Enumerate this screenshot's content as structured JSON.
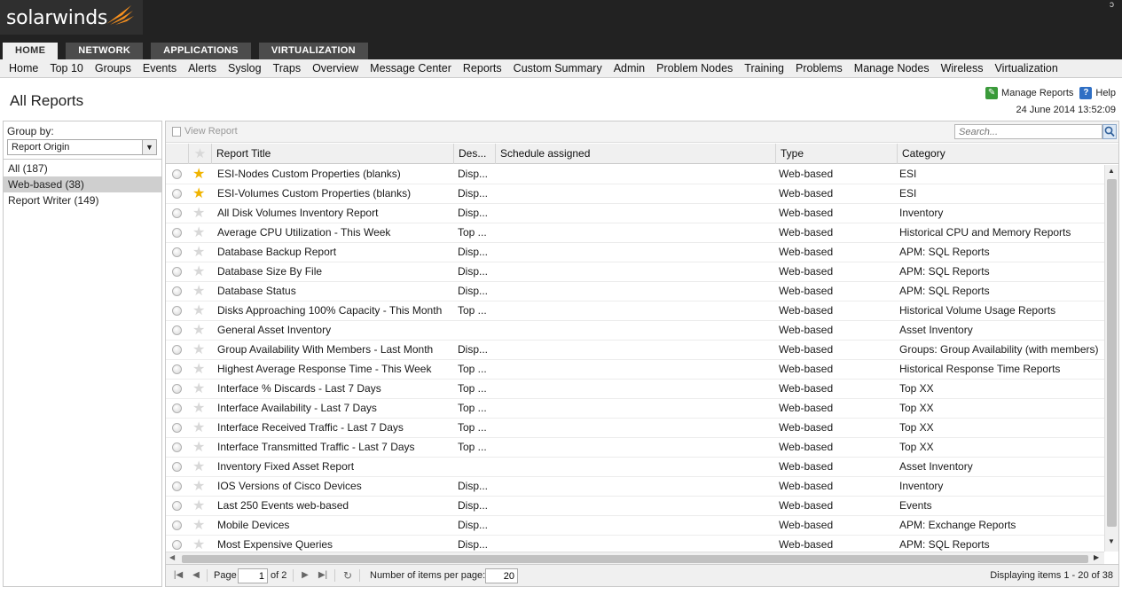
{
  "header": {
    "brand": "solarwinds",
    "corner_mark": "ɔ"
  },
  "modules": [
    "HOME",
    "NETWORK",
    "APPLICATIONS",
    "VIRTUALIZATION"
  ],
  "menu": [
    "Home",
    "Top 10",
    "Groups",
    "Events",
    "Alerts",
    "Syslog",
    "Traps",
    "Overview",
    "Message Center",
    "Reports",
    "Custom Summary",
    "Admin",
    "Problem Nodes",
    "Training",
    "Problems",
    "Manage Nodes",
    "Wireless",
    "Virtualization"
  ],
  "page": {
    "title": "All Reports",
    "manage_reports": "Manage Reports",
    "help": "Help",
    "timestamp": "24 June 2014 13:52:09"
  },
  "left_panel": {
    "group_by_label": "Group by:",
    "group_by_value": "Report Origin",
    "groups": [
      {
        "label": "All (187)",
        "selected": false
      },
      {
        "label": "Web-based (38)",
        "selected": true
      },
      {
        "label": "Report Writer (149)",
        "selected": false
      }
    ]
  },
  "grid": {
    "view_report": "View Report",
    "search_placeholder": "Search...",
    "columns": [
      "Report Title",
      "Des...",
      "Schedule assigned",
      "Type",
      "Category"
    ],
    "rows": [
      {
        "fav": true,
        "title": "ESI-Nodes Custom Properties (blanks)",
        "desc": "Disp...",
        "schedule": "",
        "type": "Web-based",
        "category": "ESI"
      },
      {
        "fav": true,
        "title": "ESI-Volumes Custom Properties (blanks)",
        "desc": "Disp...",
        "schedule": "",
        "type": "Web-based",
        "category": "ESI"
      },
      {
        "fav": false,
        "title": "All Disk Volumes Inventory Report",
        "desc": "Disp...",
        "schedule": "",
        "type": "Web-based",
        "category": "Inventory"
      },
      {
        "fav": false,
        "title": "Average CPU Utilization - This Week",
        "desc": "Top ...",
        "schedule": "",
        "type": "Web-based",
        "category": "Historical CPU and Memory Reports"
      },
      {
        "fav": false,
        "title": "Database Backup Report",
        "desc": "Disp...",
        "schedule": "",
        "type": "Web-based",
        "category": "APM: SQL Reports"
      },
      {
        "fav": false,
        "title": "Database Size By File",
        "desc": "Disp...",
        "schedule": "",
        "type": "Web-based",
        "category": "APM: SQL Reports"
      },
      {
        "fav": false,
        "title": "Database Status",
        "desc": "Disp...",
        "schedule": "",
        "type": "Web-based",
        "category": "APM: SQL Reports"
      },
      {
        "fav": false,
        "title": "Disks Approaching 100% Capacity - This Month",
        "desc": "Top ...",
        "schedule": "",
        "type": "Web-based",
        "category": "Historical Volume Usage Reports"
      },
      {
        "fav": false,
        "title": "General Asset Inventory",
        "desc": "",
        "schedule": "",
        "type": "Web-based",
        "category": "Asset Inventory"
      },
      {
        "fav": false,
        "title": "Group Availability With Members - Last Month",
        "desc": "Disp...",
        "schedule": "",
        "type": "Web-based",
        "category": "Groups: Group Availability (with members)"
      },
      {
        "fav": false,
        "title": "Highest Average Response Time - This Week",
        "desc": "Top ...",
        "schedule": "",
        "type": "Web-based",
        "category": "Historical Response Time Reports"
      },
      {
        "fav": false,
        "title": "Interface % Discards - Last 7 Days",
        "desc": "Top ...",
        "schedule": "",
        "type": "Web-based",
        "category": "Top XX"
      },
      {
        "fav": false,
        "title": "Interface Availability - Last 7 Days",
        "desc": "Top ...",
        "schedule": "",
        "type": "Web-based",
        "category": "Top XX"
      },
      {
        "fav": false,
        "title": "Interface Received Traffic - Last 7 Days",
        "desc": "Top ...",
        "schedule": "",
        "type": "Web-based",
        "category": "Top XX"
      },
      {
        "fav": false,
        "title": "Interface Transmitted Traffic - Last 7 Days",
        "desc": "Top ...",
        "schedule": "",
        "type": "Web-based",
        "category": "Top XX"
      },
      {
        "fav": false,
        "title": "Inventory Fixed Asset Report",
        "desc": "",
        "schedule": "",
        "type": "Web-based",
        "category": "Asset Inventory"
      },
      {
        "fav": false,
        "title": "IOS Versions of Cisco Devices",
        "desc": "Disp...",
        "schedule": "",
        "type": "Web-based",
        "category": "Inventory"
      },
      {
        "fav": false,
        "title": "Last 250 Events web-based",
        "desc": "Disp...",
        "schedule": "",
        "type": "Web-based",
        "category": "Events"
      },
      {
        "fav": false,
        "title": "Mobile Devices",
        "desc": "Disp...",
        "schedule": "",
        "type": "Web-based",
        "category": "APM: Exchange Reports"
      },
      {
        "fav": false,
        "title": "Most Expensive Queries",
        "desc": "Disp...",
        "schedule": "",
        "type": "Web-based",
        "category": "APM: SQL Reports"
      }
    ]
  },
  "pager": {
    "page_label": "Page",
    "page_value": "1",
    "of_label": "of 2",
    "per_page_label": "Number of items per page:",
    "per_page_value": "20",
    "displaying": "Displaying items 1 - 20 of 38"
  }
}
